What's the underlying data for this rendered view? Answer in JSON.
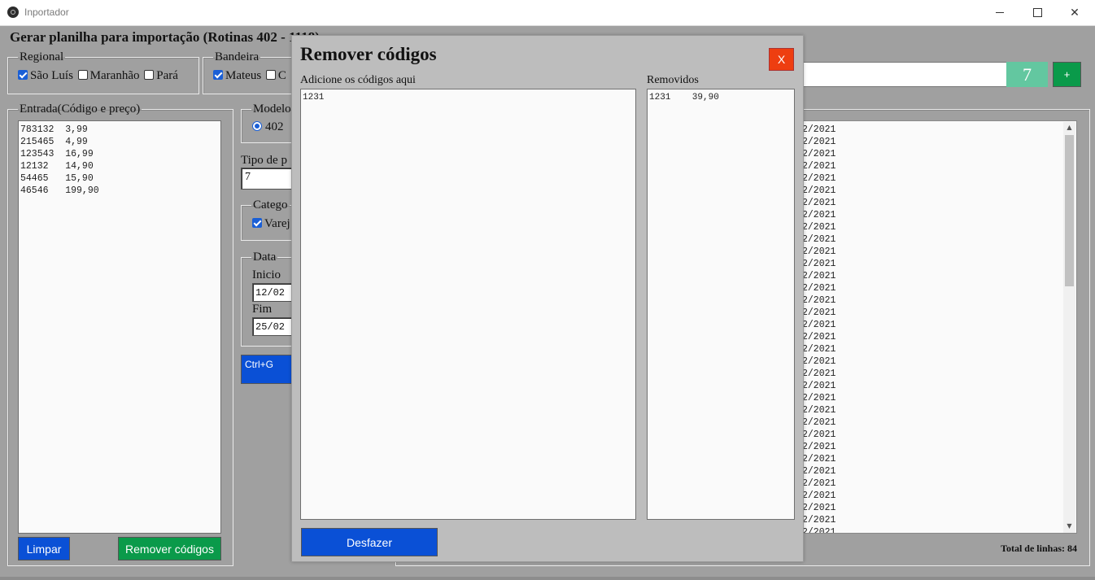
{
  "window": {
    "title": "Inportador"
  },
  "main": {
    "title": "Gerar planilha para importação (Rotinas 402 - 1118)"
  },
  "regional": {
    "legend": "Regional",
    "options": [
      {
        "label": "São Luís",
        "checked": true
      },
      {
        "label": "Maranhão",
        "checked": false
      },
      {
        "label": "Pará",
        "checked": false
      }
    ]
  },
  "bandeira": {
    "legend": "Bandeira",
    "options": [
      {
        "label": "Mateus",
        "checked": true
      },
      {
        "label": "C",
        "checked": false
      }
    ]
  },
  "top_right": {
    "count": "7",
    "add_label": "+"
  },
  "entrada": {
    "legend": "Entrada(Código e preço)",
    "lines": [
      "783132  3,99",
      "215465  4,99",
      "123543  16,99",
      "12132   14,90",
      "54465   15,90",
      "46546   199,90"
    ],
    "clear_label": "Limpar",
    "remove_label": "Remover códigos"
  },
  "modelo": {
    "legend": "Modelo",
    "selected": "402"
  },
  "tipo": {
    "label": "Tipo de p",
    "value": "7"
  },
  "categoria": {
    "legend": "Catego",
    "option": "Varej",
    "checked": true
  },
  "data": {
    "legend": "Data",
    "inicio_label": "Inicio",
    "inicio_value": "12/02",
    "fim_label": "Fim",
    "fim_value": "25/02"
  },
  "generate_button": {
    "label": "Ctrl+G"
  },
  "output": {
    "lines": [
      "2/2021",
      "2/2021",
      "2/2021",
      "2/2021",
      "2/2021",
      "2/2021",
      "2/2021",
      "2/2021",
      "2/2021",
      "2/2021",
      "2/2021",
      "2/2021",
      "2/2021",
      "2/2021",
      "2/2021",
      "2/2021",
      "2/2021",
      "2/2021",
      "2/2021",
      "2/2021",
      "2/2021",
      "2/2021",
      "2/2021",
      "2/2021",
      "2/2021",
      "2/2021",
      "2/2021",
      "2/2021",
      "2/2021",
      "2/2021",
      "2/2021",
      "2/2021",
      "2/2021",
      "2/2021",
      "2/2021",
      "2/2021"
    ],
    "total_label": "Total de linhas: 84"
  },
  "modal": {
    "title": "Remover códigos",
    "close_label": "X",
    "add_label": "Adicione os códigos aqui",
    "add_value": "1231",
    "removed_label": "Removidos",
    "removed_value": "1231    39,90",
    "undo_label": "Desfazer"
  }
}
